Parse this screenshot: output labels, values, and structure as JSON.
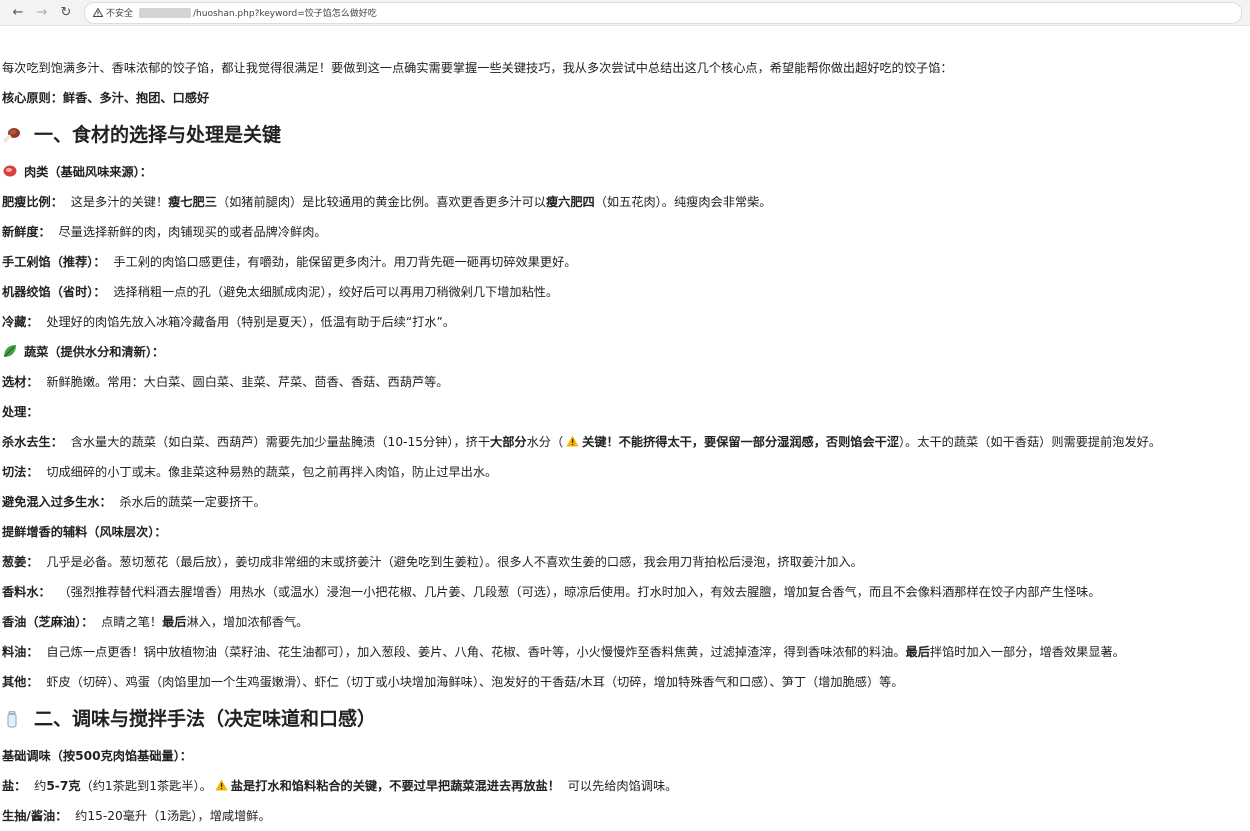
{
  "browser": {
    "insecure_label": "不安全",
    "url_path": "/huoshan.php?keyword=饺子馅怎么做好吃"
  },
  "intro": "每次吃到饱满多汁、香味浓郁的饺子馅，都让我觉得很满足！要做到这一点确实需要掌握一些关键技巧，我从多次尝试中总结出这几个核心点，希望能帮你做出超好吃的饺子馅：",
  "core_principle": "核心原则：鲜香、多汁、抱团、口感好",
  "section1": {
    "title": "一、食材的选择与处理是关键",
    "meat_heading": "肉类（基础风味来源）：",
    "meat_items": [
      {
        "label": "肥瘦比例：",
        "parts": [
          "这是多汁的关键！",
          "瘦七肥三",
          "（如猪前腿肉）是比较通用的黄金比例。喜欢更香更多汁可以",
          "瘦六肥四",
          "（如五花肉）。纯瘦肉会非常柴。"
        ]
      },
      {
        "label": "新鲜度：",
        "text": "尽量选择新鲜的肉，肉铺现买的或者品牌冷鲜肉。"
      },
      {
        "label": "手工剁馅（推荐）：",
        "text": "手工剁的肉馅口感更佳，有嚼劲，能保留更多肉汁。用刀背先砸一砸再切碎效果更好。"
      },
      {
        "label": "机器绞馅（省时）：",
        "text": "选择稍粗一点的孔（避免太细腻成肉泥），绞好后可以再用刀稍微剁几下增加粘性。"
      },
      {
        "label": "冷藏：",
        "text": "处理好的肉馅先放入冰箱冷藏备用（特别是夏天），低温有助于后续“打水”。"
      }
    ],
    "veg_heading": "蔬菜（提供水分和清新）：",
    "veg_select": {
      "label": "选材：",
      "text": "新鲜脆嫩。常用：大白菜、圆白菜、韭菜、芹菜、茴香、香菇、西葫芦等。"
    },
    "veg_process": "处理：",
    "veg_items": [
      {
        "label": "杀水去生：",
        "parts": [
          "含水量大的蔬菜（如白菜、西葫芦）需要先加少量盐腌渍（10-15分钟），挤干",
          "大部分",
          "水分（",
          "关键！不能挤得太干，要保留一部分湿润感，否则馅会干涩",
          "）。太干的蔬菜（如干香菇）则需要提前泡发好。"
        ]
      },
      {
        "label": "切法：",
        "text": "切成细碎的小丁或末。像韭菜这种易熟的蔬菜，包之前再拌入肉馅，防止过早出水。"
      },
      {
        "label": "避免混入过多生水：",
        "text": "杀水后的蔬菜一定要挤干。"
      }
    ],
    "aux_heading": "提鲜增香的辅料（风味层次）：",
    "aux_items": [
      {
        "label": "葱姜：",
        "text": "几乎是必备。葱切葱花（最后放），姜切成非常细的末或挤姜汁（避免吃到生姜粒）。很多人不喜欢生姜的口感，我会用刀背拍松后浸泡，挤取姜汁加入。"
      },
      {
        "label": "香料水：",
        "text": "（强烈推荐替代料酒去腥增香）用热水（或温水）浸泡一小把花椒、几片姜、几段葱（可选），晾凉后使用。打水时加入，有效去腥膻，增加复合香气，而且不会像料酒那样在饺子内部产生怪味。"
      },
      {
        "label": "香油（芝麻油）：",
        "parts": [
          "点睛之笔！",
          "最后",
          "淋入，增加浓郁香气。"
        ]
      },
      {
        "label": "料油：",
        "parts": [
          "自己炼一点更香！锅中放植物油（菜籽油、花生油都可），加入葱段、姜片、八角、花椒、香叶等，小火慢慢炸至香料焦黄，过滤掉渣滓，得到香味浓郁的料油。",
          "最后",
          "拌馅时加入一部分，增香效果显著。"
        ]
      },
      {
        "label": "其他：",
        "text": "虾皮（切碎）、鸡蛋（肉馅里加一个生鸡蛋嫩滑）、虾仁（切丁或小块增加海鲜味）、泡发好的干香菇/木耳（切碎，增加特殊香气和口感）、笋丁（增加脆感）等。"
      }
    ]
  },
  "section2": {
    "title": "二、调味与搅拌手法（决定味道和口感）",
    "base_heading": "基础调味（按500克肉馅基础量）：",
    "salt": {
      "label": "盐：",
      "parts": [
        "约",
        "5-7克",
        "（约1茶匙到1茶匙半）。",
        "盐是打水和馅料粘合的关键，不要过早把蔬菜混进去再放盐！",
        "可以先给肉馅调味。"
      ]
    },
    "soy": {
      "label": "生抽/酱油：",
      "text": "约15-20毫升（1汤匙），增咸增鲜。"
    }
  }
}
